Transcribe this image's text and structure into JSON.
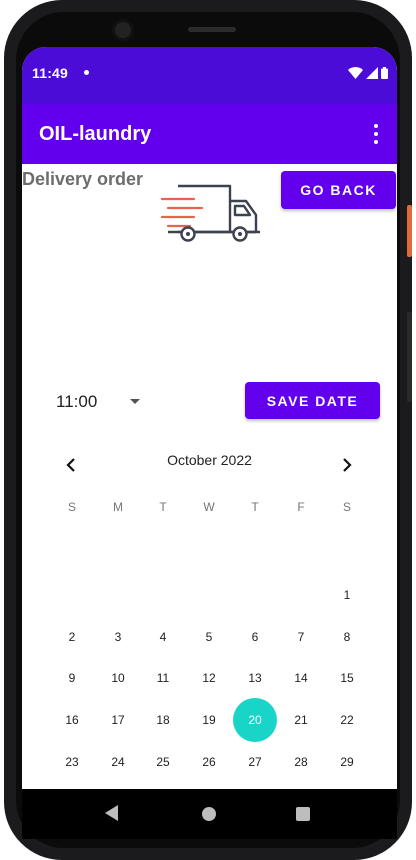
{
  "status_bar": {
    "time": "11:49"
  },
  "app_bar": {
    "title": "OIL-laundry"
  },
  "page": {
    "heading": "Delivery order"
  },
  "buttons": {
    "go_back": "GO BACK",
    "save_date": "SAVE DATE"
  },
  "time_picker": {
    "value": "11:00"
  },
  "calendar": {
    "month_label": "October 2022",
    "weekdays": [
      "S",
      "M",
      "T",
      "W",
      "T",
      "F",
      "S"
    ],
    "first_weekday_index": 6,
    "days_in_month": 31,
    "selected_day": 20,
    "selected_color": "#18d5c8"
  },
  "colors": {
    "primary": "#6200ee",
    "status_bar": "#4a0cd6",
    "accent": "#18d5c8"
  }
}
